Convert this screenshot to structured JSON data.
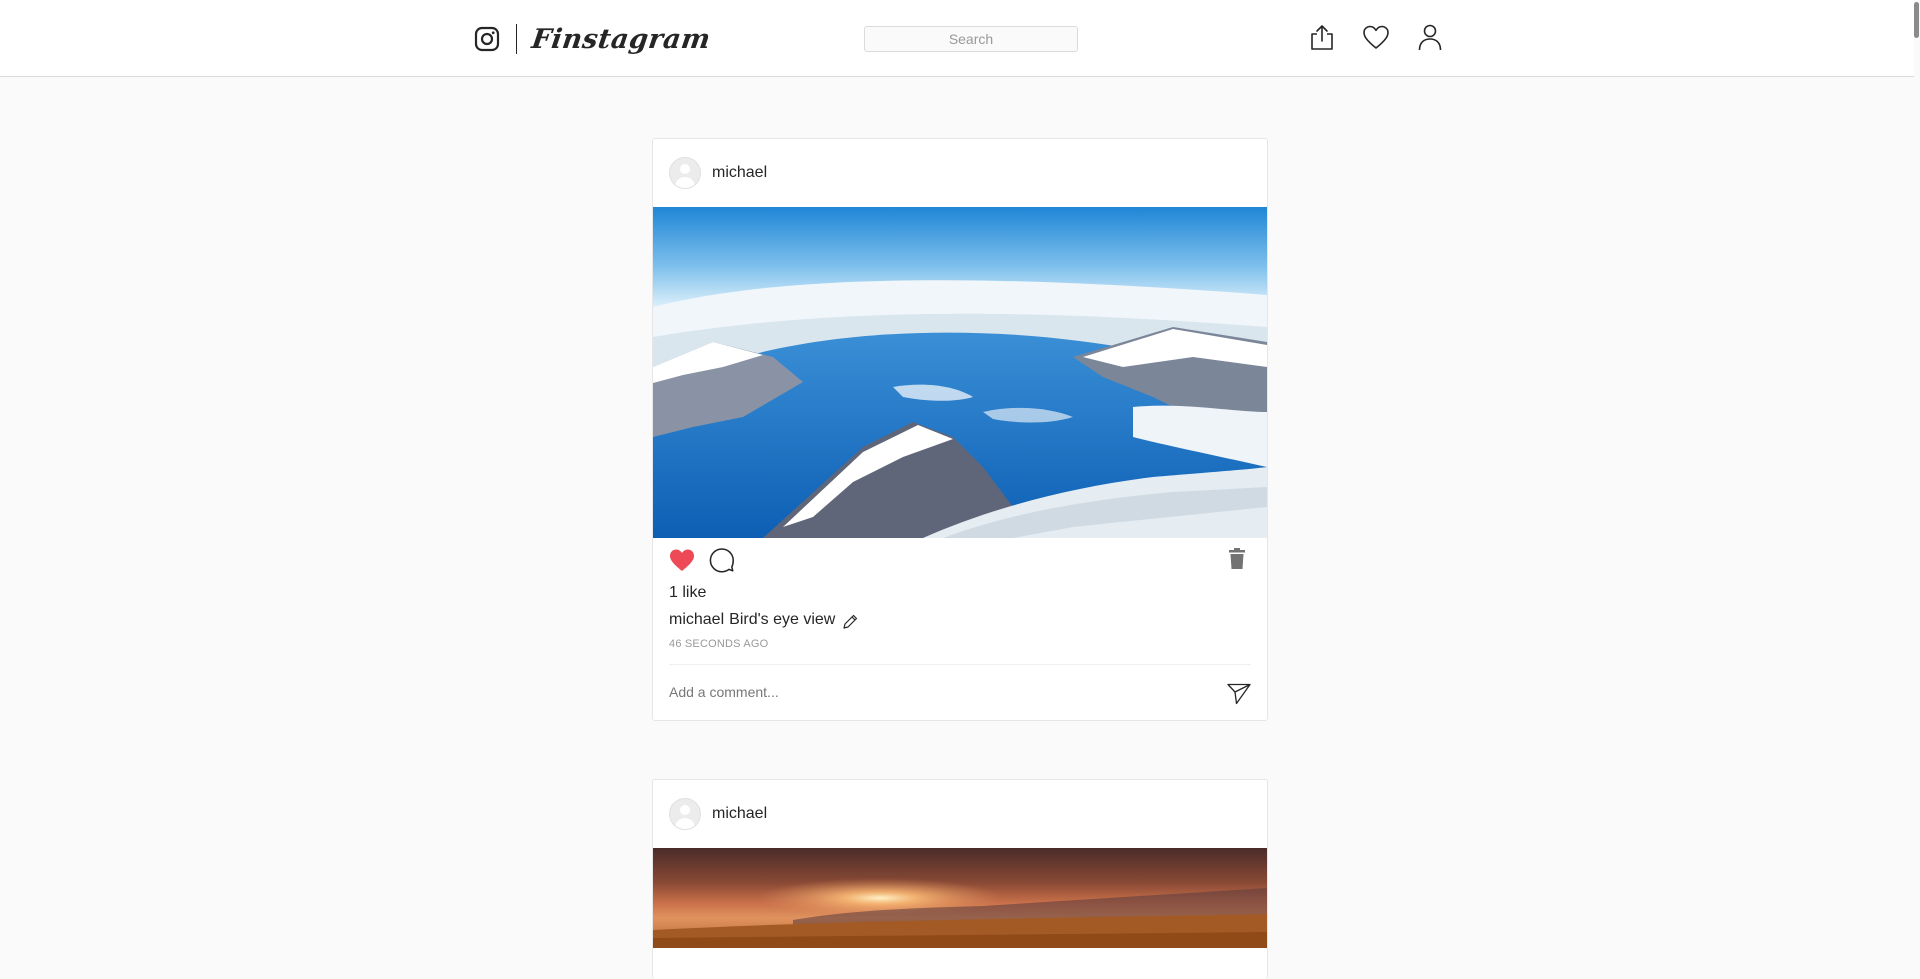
{
  "app": {
    "name": "Finstagram"
  },
  "search": {
    "placeholder": "Search"
  },
  "posts": [
    {
      "username": "michael",
      "likes_text": "1 like",
      "liked": true,
      "caption_user": "michael",
      "caption_text": "Bird's eye view",
      "timestamp": "46 SECONDS AGO",
      "comment_placeholder": "Add a comment...",
      "image_subject": "aerial view of snow-covered mountains and blue fjord"
    },
    {
      "username": "michael",
      "image_subject": "sunset over a misty field with trees"
    }
  ],
  "colors": {
    "like_red": "#ed4956",
    "border": "#dbdbdb",
    "background": "#fafafa",
    "muted_text": "#999999"
  }
}
